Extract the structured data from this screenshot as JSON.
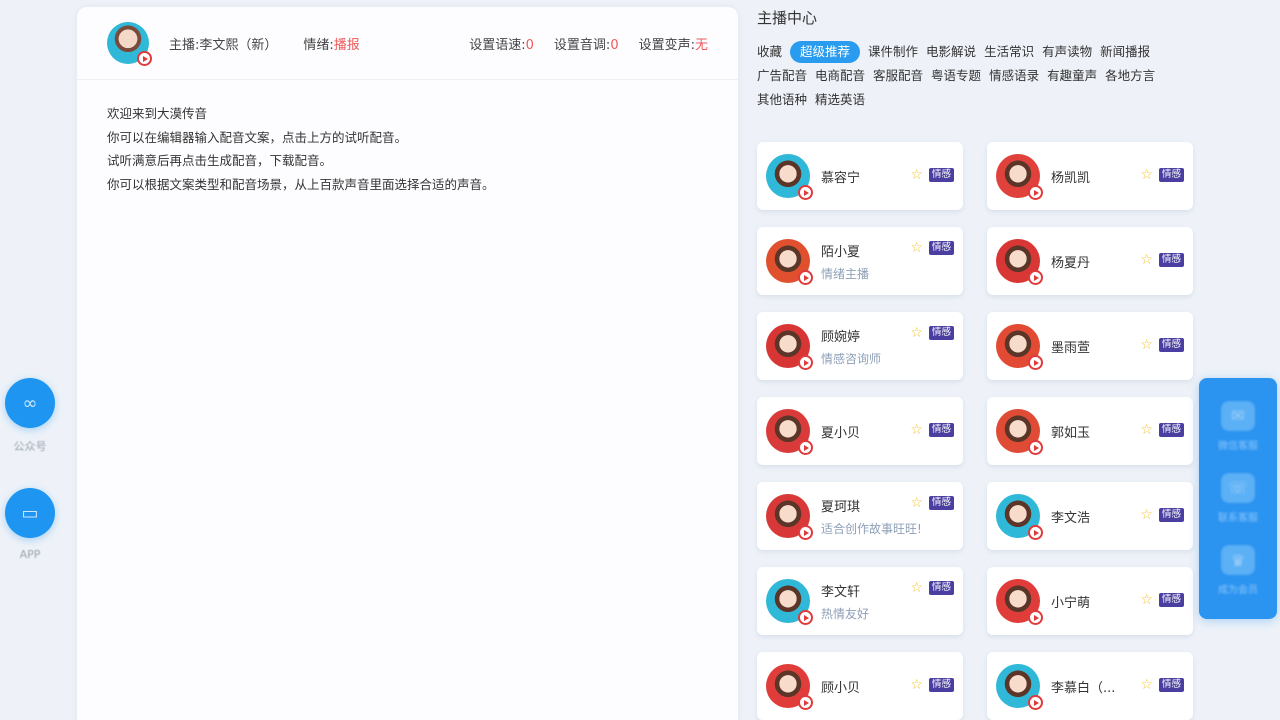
{
  "left_float": [
    {
      "label": "公众号",
      "icon": "wechat-official-icon"
    },
    {
      "label": "APP",
      "icon": "app-icon"
    }
  ],
  "editor": {
    "anchor_label": "主播:李文熙（新）",
    "mood_label": "情绪:",
    "mood_value": "播报",
    "settings": [
      {
        "label": "设置语速:",
        "value": "0"
      },
      {
        "label": "设置音调:",
        "value": "0"
      },
      {
        "label": "设置变声:",
        "value": "无"
      }
    ],
    "body_lines": [
      "欢迎来到大漠传音",
      "你可以在编辑器输入配音文案，点击上方的试听配音。",
      "试听满意后再点击生成配音，下载配音。",
      "你可以根据文案类型和配音场景，从上百款声音里面选择合适的声音。"
    ]
  },
  "right_panel": {
    "title": "主播中心",
    "tags": [
      {
        "label": "收藏",
        "active": false
      },
      {
        "label": "超级推荐",
        "active": true
      },
      {
        "label": "课件制作",
        "active": false
      },
      {
        "label": "电影解说",
        "active": false
      },
      {
        "label": "生活常识",
        "active": false
      },
      {
        "label": "有声读物",
        "active": false
      },
      {
        "label": "新闻播报",
        "active": false
      },
      {
        "label": "广告配音",
        "active": false
      },
      {
        "label": "电商配音",
        "active": false
      },
      {
        "label": "客服配音",
        "active": false
      },
      {
        "label": "粤语专题",
        "active": false
      },
      {
        "label": "情感语录",
        "active": false
      },
      {
        "label": "有趣童声",
        "active": false
      },
      {
        "label": "各地方言",
        "active": false
      },
      {
        "label": "其他语种",
        "active": false
      },
      {
        "label": "精选英语",
        "active": false
      }
    ],
    "badge_label": "情感",
    "star_icon": "star-icon",
    "voices": [
      {
        "name": "慕容宁",
        "sub": "",
        "avatar_bg": "#2fb8d8"
      },
      {
        "name": "杨凯凯",
        "sub": "",
        "avatar_bg": "#e0413b"
      },
      {
        "name": "陌小夏",
        "sub": "情绪主播",
        "avatar_bg": "#e0502e"
      },
      {
        "name": "杨夏丹",
        "sub": "",
        "avatar_bg": "#d93636"
      },
      {
        "name": "顾婉婷",
        "sub": "情感咨询师",
        "avatar_bg": "#d83535"
      },
      {
        "name": "墨雨萱",
        "sub": "",
        "avatar_bg": "#e24a33"
      },
      {
        "name": "夏小贝",
        "sub": "",
        "avatar_bg": "#d93a3a"
      },
      {
        "name": "郭如玉",
        "sub": "",
        "avatar_bg": "#e04b35"
      },
      {
        "name": "夏珂琪",
        "sub": "适合创作故事旺旺!",
        "avatar_bg": "#d83838"
      },
      {
        "name": "李文浩",
        "sub": "",
        "avatar_bg": "#2fb8d8"
      },
      {
        "name": "李文轩",
        "sub": "热情友好",
        "avatar_bg": "#2fb8d8"
      },
      {
        "name": "小宁萌",
        "sub": "",
        "avatar_bg": "#e03d3a"
      },
      {
        "name": "顾小贝",
        "sub": "",
        "avatar_bg": "#e03d3a"
      },
      {
        "name": "李慕白（...",
        "sub": "",
        "avatar_bg": "#2fb8d8"
      }
    ]
  },
  "float_panel": [
    {
      "label": "微信客服",
      "icon": "wechat-icon"
    },
    {
      "label": "联系客服",
      "icon": "chat-icon"
    },
    {
      "label": "成为会员",
      "icon": "member-icon"
    }
  ],
  "colors": {
    "accent": "#2a9cf0",
    "badge": "#4a3fa0",
    "warning_red": "#ef5a5a",
    "star": "#f4c330"
  }
}
